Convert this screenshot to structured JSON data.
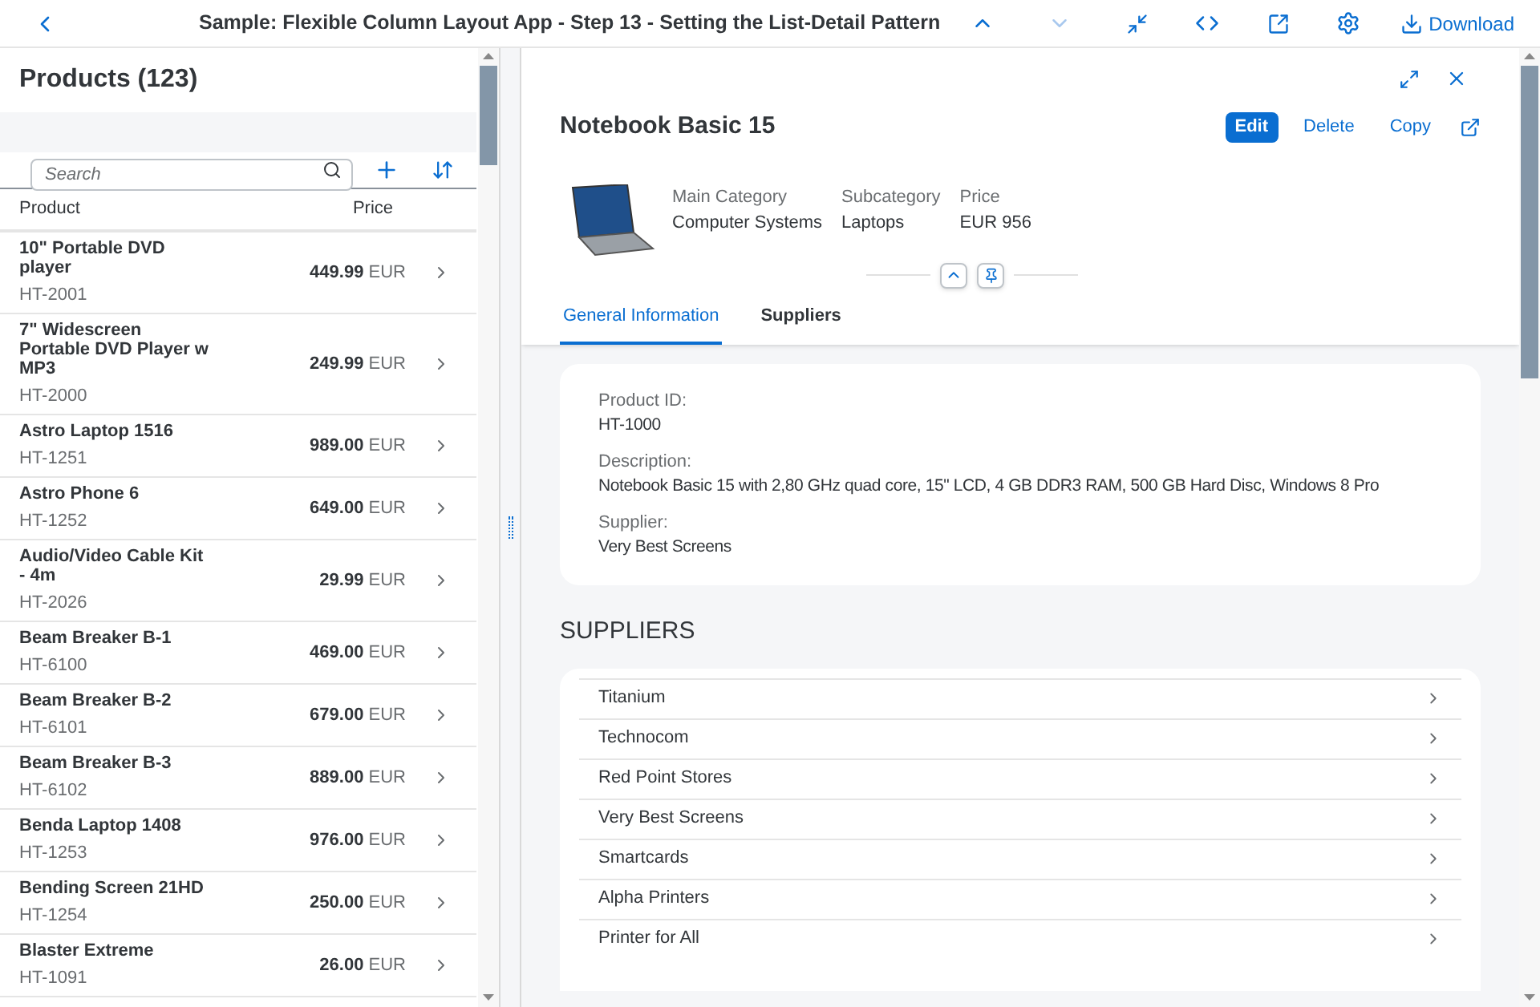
{
  "top_bar": {
    "title": "Sample: Flexible Column Layout App - Step 13 - Setting the List-Detail Pattern",
    "download": "Download"
  },
  "list": {
    "title": "Products (123)",
    "search": {
      "placeholder": "Search"
    },
    "columns": [
      "Product",
      "Price"
    ],
    "rows": [
      {
        "name": "10\" Portable DVD player",
        "id": "HT-2001",
        "price": "449.99",
        "currency": "EUR"
      },
      {
        "name": "7\" Widescreen Portable DVD Player w MP3",
        "id": "HT-2000",
        "price": "249.99",
        "currency": "EUR"
      },
      {
        "name": "Astro Laptop 1516",
        "id": "HT-1251",
        "price": "989.00",
        "currency": "EUR"
      },
      {
        "name": "Astro Phone 6",
        "id": "HT-1252",
        "price": "649.00",
        "currency": "EUR"
      },
      {
        "name": "Audio/Video Cable Kit - 4m",
        "id": "HT-2026",
        "price": "29.99",
        "currency": "EUR"
      },
      {
        "name": "Beam Breaker B-1",
        "id": "HT-6100",
        "price": "469.00",
        "currency": "EUR"
      },
      {
        "name": "Beam Breaker B-2",
        "id": "HT-6101",
        "price": "679.00",
        "currency": "EUR"
      },
      {
        "name": "Beam Breaker B-3",
        "id": "HT-6102",
        "price": "889.00",
        "currency": "EUR"
      },
      {
        "name": "Benda Laptop 1408",
        "id": "HT-1253",
        "price": "976.00",
        "currency": "EUR"
      },
      {
        "name": "Bending Screen 21HD",
        "id": "HT-1254",
        "price": "250.00",
        "currency": "EUR"
      },
      {
        "name": "Blaster Extreme",
        "id": "HT-1091",
        "price": "26.00",
        "currency": "EUR"
      }
    ]
  },
  "detail": {
    "title": "Notebook Basic 15",
    "actions": [
      {
        "label": "Edit",
        "kind": "emphasized"
      },
      {
        "label": "Delete",
        "kind": "transparent"
      },
      {
        "label": "Copy",
        "kind": "transparent"
      }
    ],
    "header_fields": [
      {
        "label": "Main Category",
        "value": "Computer Systems"
      },
      {
        "label": "Subcategory",
        "value": "Laptops"
      },
      {
        "label": "Price",
        "value": "EUR 956"
      }
    ],
    "tabs": [
      {
        "label": "General Information",
        "selected": true
      },
      {
        "label": "Suppliers",
        "selected": false
      }
    ],
    "info_fields": [
      {
        "label": "Product ID:",
        "value": "HT-1000"
      },
      {
        "label": "Description:",
        "value": "Notebook Basic 15 with 2,80 GHz quad core, 15\" LCD, 4 GB DDR3 RAM, 500 GB Hard Disc, Windows 8 Pro"
      },
      {
        "label": "Supplier:",
        "value": "Very Best Screens"
      }
    ],
    "suppliers_title": "SUPPLIERS",
    "suppliers": [
      "Titanium",
      "Technocom",
      "Red Point Stores",
      "Very Best Screens",
      "Smartcards",
      "Alpha Printers",
      "Printer for All"
    ]
  }
}
